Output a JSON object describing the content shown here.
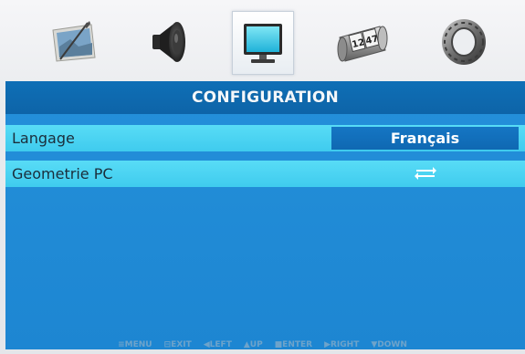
{
  "menu_tabs": [
    {
      "icon": "picture-icon",
      "active": false
    },
    {
      "icon": "speaker-icon",
      "active": false
    },
    {
      "icon": "monitor-icon",
      "active": true
    },
    {
      "icon": "clock-icon",
      "active": false,
      "clock_text": [
        "12",
        "47"
      ]
    },
    {
      "icon": "gear-ring-icon",
      "active": false
    }
  ],
  "panel": {
    "title": "CONFIGURATION",
    "rows": [
      {
        "label": "Langage",
        "value": "Français"
      },
      {
        "label": "Geometrie PC",
        "value_icon": "enter-arrows-icon"
      }
    ]
  },
  "footer": {
    "hints": [
      "≡MENU",
      "⊟EXIT",
      "◀LEFT",
      "▲UP",
      "■ENTER",
      "▶RIGHT",
      "▼DOWN"
    ]
  },
  "colors": {
    "panel_blue": "#1f8fd8",
    "header_blue": "#0f6fb6",
    "row_cyan": "#48d4f2",
    "value_box_blue": "#1576c4"
  }
}
